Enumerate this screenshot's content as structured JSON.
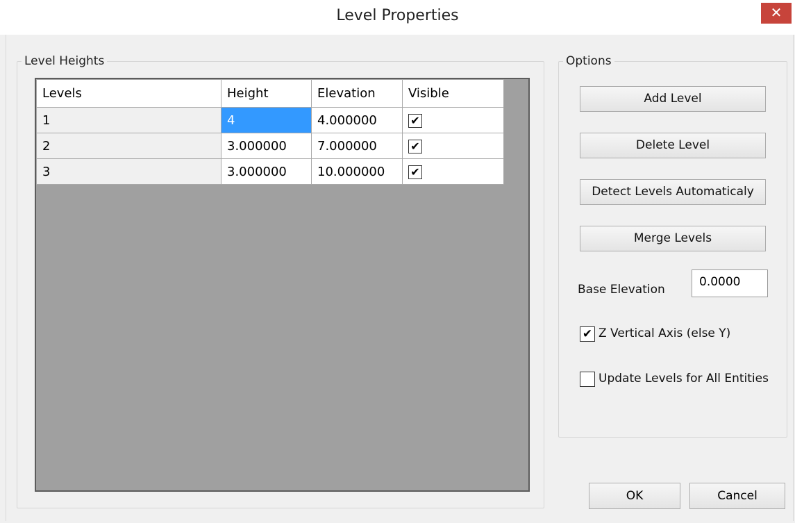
{
  "window": {
    "title": "Level Properties",
    "close_glyph": "✕"
  },
  "level_heights": {
    "legend": "Level Heights",
    "columns": [
      "Levels",
      "Height",
      "Elevation",
      "Visible"
    ],
    "rows": [
      {
        "level": "1",
        "height": "4",
        "elevation": "4.000000",
        "visible": true
      },
      {
        "level": "2",
        "height": "3.000000",
        "elevation": "7.000000",
        "visible": true
      },
      {
        "level": "3",
        "height": "3.000000",
        "elevation": "10.000000",
        "visible": true
      }
    ]
  },
  "options": {
    "legend": "Options",
    "add_level": "Add Level",
    "delete_level": "Delete Level",
    "detect_levels": "Detect Levels Automaticaly",
    "merge_levels": "Merge Levels",
    "base_elevation_label": "Base Elevation",
    "base_elevation_value": "0.0000",
    "z_vertical_label": "Z Vertical Axis (else Y)",
    "z_vertical_checked": true,
    "update_levels_label": "Update Levels for All Entities",
    "update_levels_checked": false
  },
  "footer": {
    "ok": "OK",
    "cancel": "Cancel"
  },
  "colors": {
    "selection": "#3399ff",
    "close_button": "#c7443b",
    "grid_background": "#a0a0a0"
  },
  "icons": {
    "check": "✔"
  }
}
